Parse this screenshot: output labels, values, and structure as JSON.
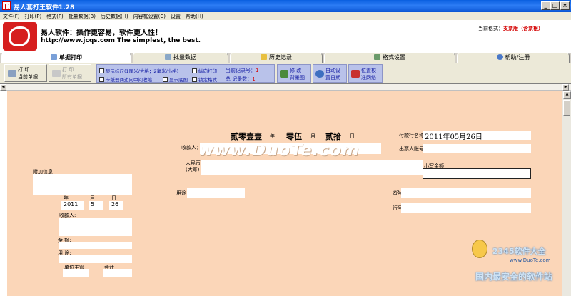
{
  "window": {
    "title": "易人套打王软件1.28",
    "btn_min": "_",
    "btn_max": "□",
    "btn_close": "×"
  },
  "menu": [
    "文件(F)",
    "打印(P)",
    "格式(F)",
    "批量数据(B)",
    "历史数据(H)",
    "内容框设置(C)",
    "设置",
    "帮助(H)"
  ],
  "banner": {
    "slogan": "易人软件：操作更容易，软件更人性！",
    "url": "http://www.jcqs.com   The simplest, the best.",
    "format_label": "当前格式：",
    "format_value": "支票版（含票根）"
  },
  "tabs": [
    "单据打印",
    "批量数据",
    "历史记录",
    "格式设置",
    "帮助/注册"
  ],
  "toolbar": {
    "print_current_1": "打   印",
    "print_current_2": "当前单据",
    "print_all_1": "打   印",
    "print_all_2": "所有单据",
    "opt_show_ruler": "显示标尺(1厘米/大格；2毫米/小格)",
    "opt_vertical": "纵向打印",
    "opt_paper_fit": "卡纸器两边向中间收缩",
    "opt_show_bg": "显示底图",
    "opt_lock": "锁定格式",
    "current_record_label": "当前记录号：",
    "current_record_value": "1",
    "total_label": "总   记录数：",
    "total_value": "1",
    "bg_1": "修   改",
    "bg_2": "背景图",
    "auto_date_1": "自动设",
    "auto_date_2": "置日期",
    "pos_1": "位置校",
    "pos_2": "准网络"
  },
  "form": {
    "year_cn": "贰零壹壹",
    "year_unit": "年",
    "month_cn": "零伍",
    "month_unit": "月",
    "day_cn": "贰拾",
    "day_unit": "日",
    "payer_bank_label": "付款行名称",
    "date_value": "2011年05月26日",
    "payee_label": "收款人：",
    "drawer_account_label": "出票人账号",
    "rmb_label_1": "人民币",
    "rmb_label_2": "(大写)",
    "small_amount_label": "小写金额",
    "extra_info_label": "附加信息",
    "usage_label": "用途",
    "password_label": "密码",
    "row_no_label": "行号",
    "stub_year_label": "年",
    "stub_month_label": "月",
    "stub_day_label": "日",
    "stub_year": "2011",
    "stub_month": "5",
    "stub_day": "26",
    "stub_payee": "收款人:",
    "stub_amount": "金   额:",
    "stub_usage": "用   途:",
    "unit_head": "单位主管",
    "accountant": "会计"
  },
  "watermark": {
    "main": "www.DuoTe.com",
    "site_name": "2345软件大全",
    "site_url": "www.DuoTe.com",
    "slogan": "国内最安全的软件站"
  },
  "colors": {
    "canvas": "#fbd6b8",
    "accent_red": "#d40000",
    "option_blue": "#b9c2ea"
  }
}
